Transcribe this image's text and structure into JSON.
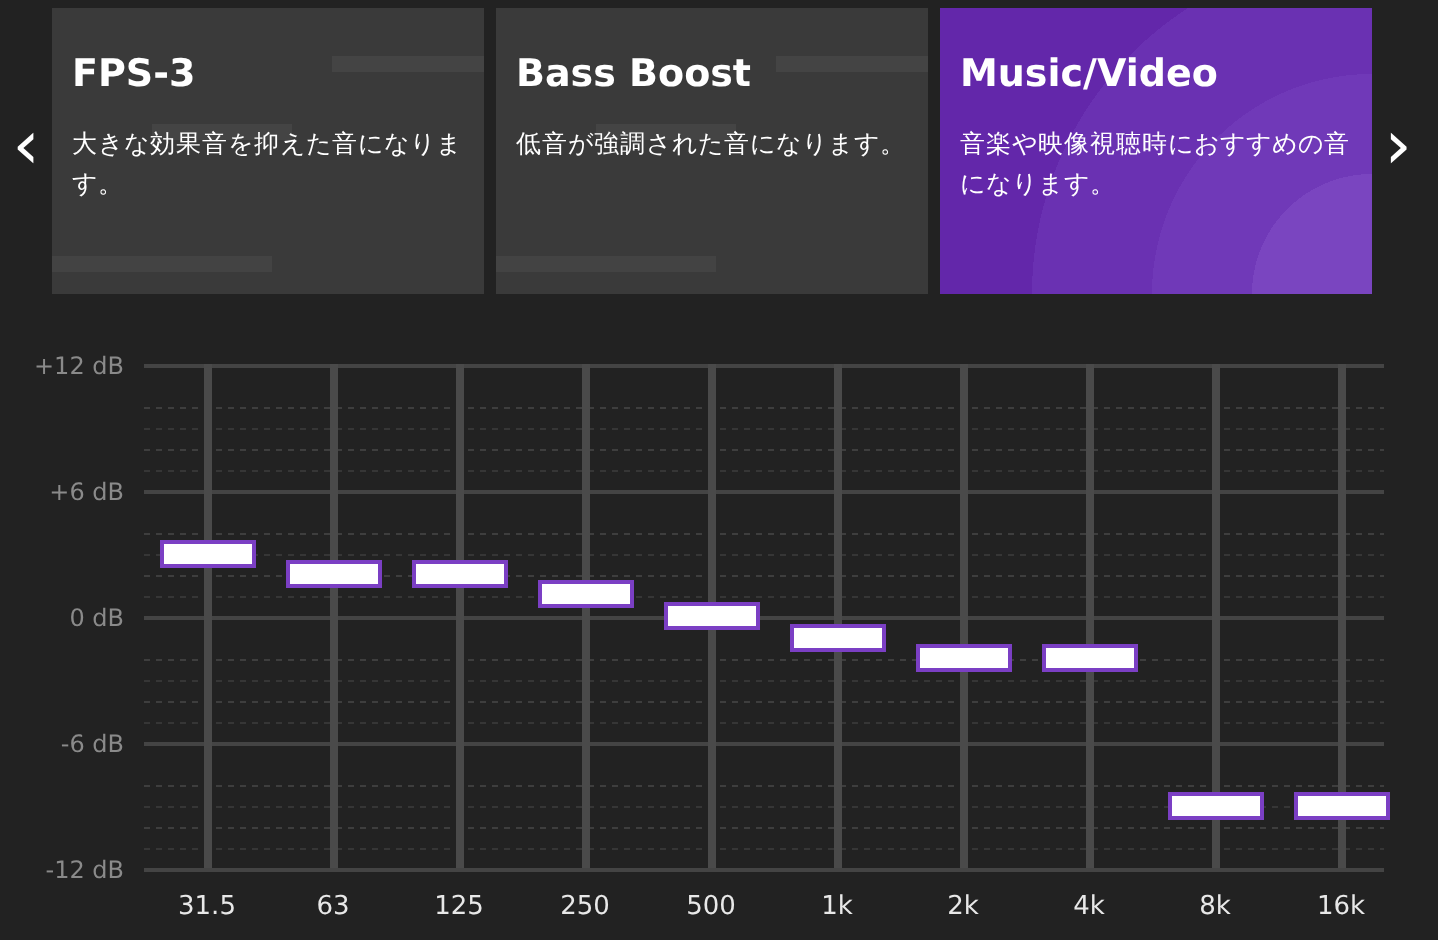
{
  "presets": [
    {
      "title": "FPS-3",
      "description": "大きな効果音を抑えた音になります。",
      "selected": false
    },
    {
      "title": "Bass Boost",
      "description": "低音が強調された音になります。",
      "selected": false
    },
    {
      "title": "Music/Video",
      "description": "音楽や映像視聴時におすすめの音になります。",
      "selected": true
    }
  ],
  "nav": {
    "prev": "‹",
    "next": "›"
  },
  "equalizer": {
    "scale": [
      "+12 dB",
      "+6 dB",
      "0 dB",
      "-6 dB",
      "-12 dB"
    ],
    "bands": [
      {
        "label": "31.5",
        "level": 0.625
      },
      {
        "label": "63",
        "level": 0.583
      },
      {
        "label": "125",
        "level": 0.583
      },
      {
        "label": "250",
        "level": 0.542
      },
      {
        "label": "500",
        "level": 0.5
      },
      {
        "label": "1k",
        "level": 0.458
      },
      {
        "label": "2k",
        "level": 0.417
      },
      {
        "label": "4k",
        "level": 0.417
      },
      {
        "label": "8k",
        "level": 0.125
      },
      {
        "label": "16k",
        "level": 0.125
      }
    ]
  }
}
